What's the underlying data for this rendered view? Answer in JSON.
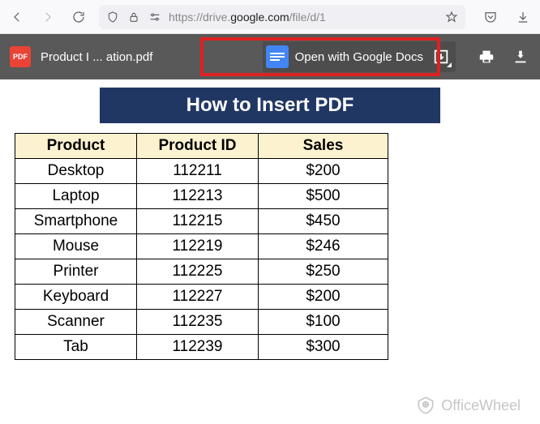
{
  "browser": {
    "url_prefix": "https://drive.",
    "url_domain": "google.com",
    "url_suffix": "/file/d/1"
  },
  "viewer": {
    "pdf_badge": "PDF",
    "filename": "Product I ... ation.pdf",
    "open_with_label": "Open with Google Docs"
  },
  "document": {
    "title": "How to Insert PDF",
    "headers": [
      "Product",
      "Product ID",
      "Sales"
    ],
    "rows": [
      {
        "product": "Desktop",
        "id": "112211",
        "sales": "$200"
      },
      {
        "product": "Laptop",
        "id": "112213",
        "sales": "$500"
      },
      {
        "product": "Smartphone",
        "id": "112215",
        "sales": "$450"
      },
      {
        "product": "Mouse",
        "id": "112219",
        "sales": "$246"
      },
      {
        "product": "Printer",
        "id": "112225",
        "sales": "$250"
      },
      {
        "product": "Keyboard",
        "id": "112227",
        "sales": "$200"
      },
      {
        "product": "Scanner",
        "id": "112235",
        "sales": "$100"
      },
      {
        "product": "Tab",
        "id": "112239",
        "sales": "$300"
      }
    ]
  },
  "watermark": "OfficeWheel",
  "chart_data": {
    "type": "table",
    "title": "How to Insert PDF",
    "headers": [
      "Product",
      "Product ID",
      "Sales"
    ],
    "rows": [
      [
        "Desktop",
        112211,
        200
      ],
      [
        "Laptop",
        112213,
        500
      ],
      [
        "Smartphone",
        112215,
        450
      ],
      [
        "Mouse",
        112219,
        246
      ],
      [
        "Printer",
        112225,
        250
      ],
      [
        "Keyboard",
        112227,
        200
      ],
      [
        "Scanner",
        112235,
        100
      ],
      [
        "Tab",
        112239,
        300
      ]
    ]
  }
}
